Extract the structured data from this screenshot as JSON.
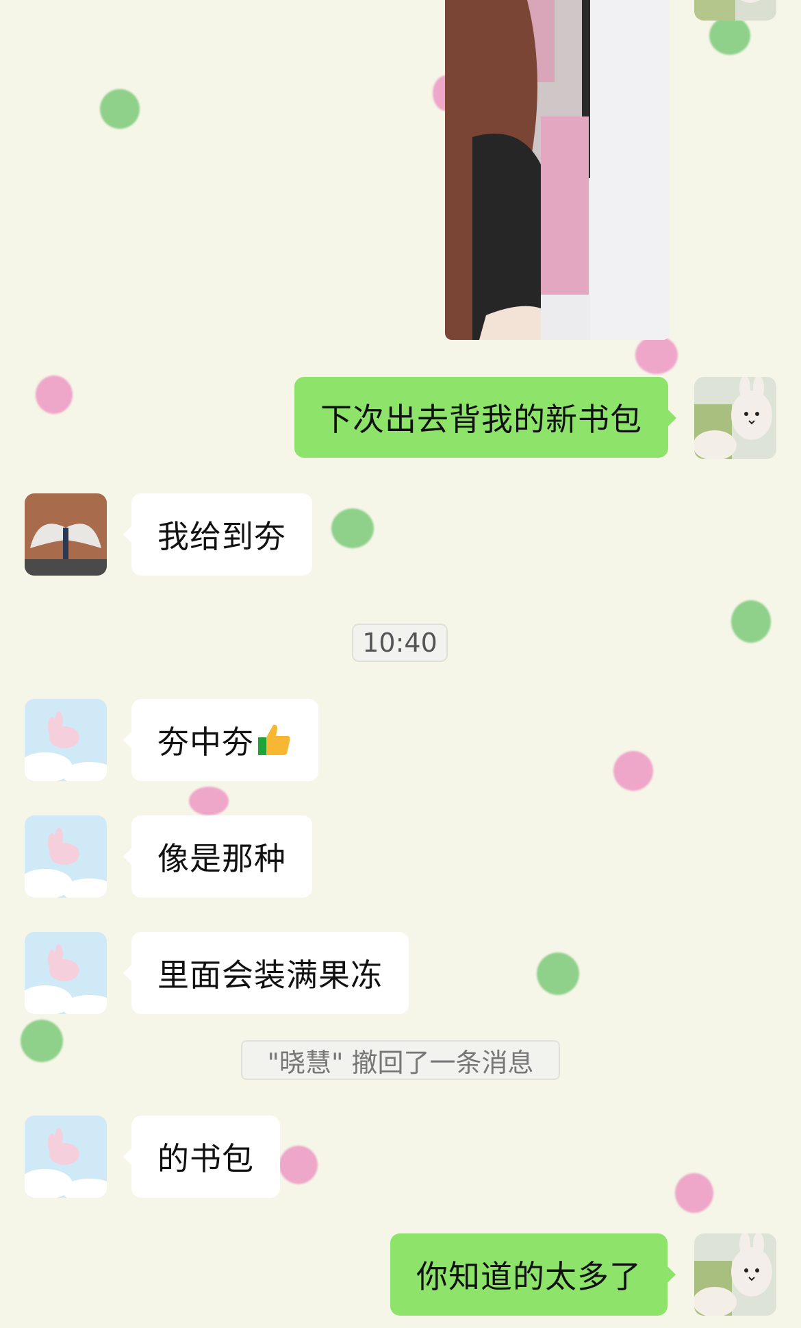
{
  "conversation": {
    "messages": [
      {
        "from": "me",
        "type": "text",
        "text": "下次出去背我的新书包"
      },
      {
        "from": "other_b",
        "type": "text",
        "text": "我给到夯"
      },
      {
        "type": "time",
        "text": "10:40"
      },
      {
        "from": "other_a",
        "type": "text",
        "text": "夯中夯",
        "emoji": "thumbs-up"
      },
      {
        "from": "other_a",
        "type": "text",
        "text": "像是那种"
      },
      {
        "from": "other_a",
        "type": "text",
        "text": "里面会装满果冻"
      },
      {
        "type": "system",
        "text": "\"晓慧\" 撤回了一条消息"
      },
      {
        "from": "other_a",
        "type": "text",
        "text": "的书包"
      },
      {
        "from": "me",
        "type": "text",
        "text": "你知道的太多了"
      }
    ]
  },
  "colors": {
    "background": "#f5f6e8",
    "bubble_out": "#8ee36a",
    "bubble_in": "#ffffff",
    "dot_green": "#8fd08a",
    "dot_pink": "#eea6c9"
  }
}
